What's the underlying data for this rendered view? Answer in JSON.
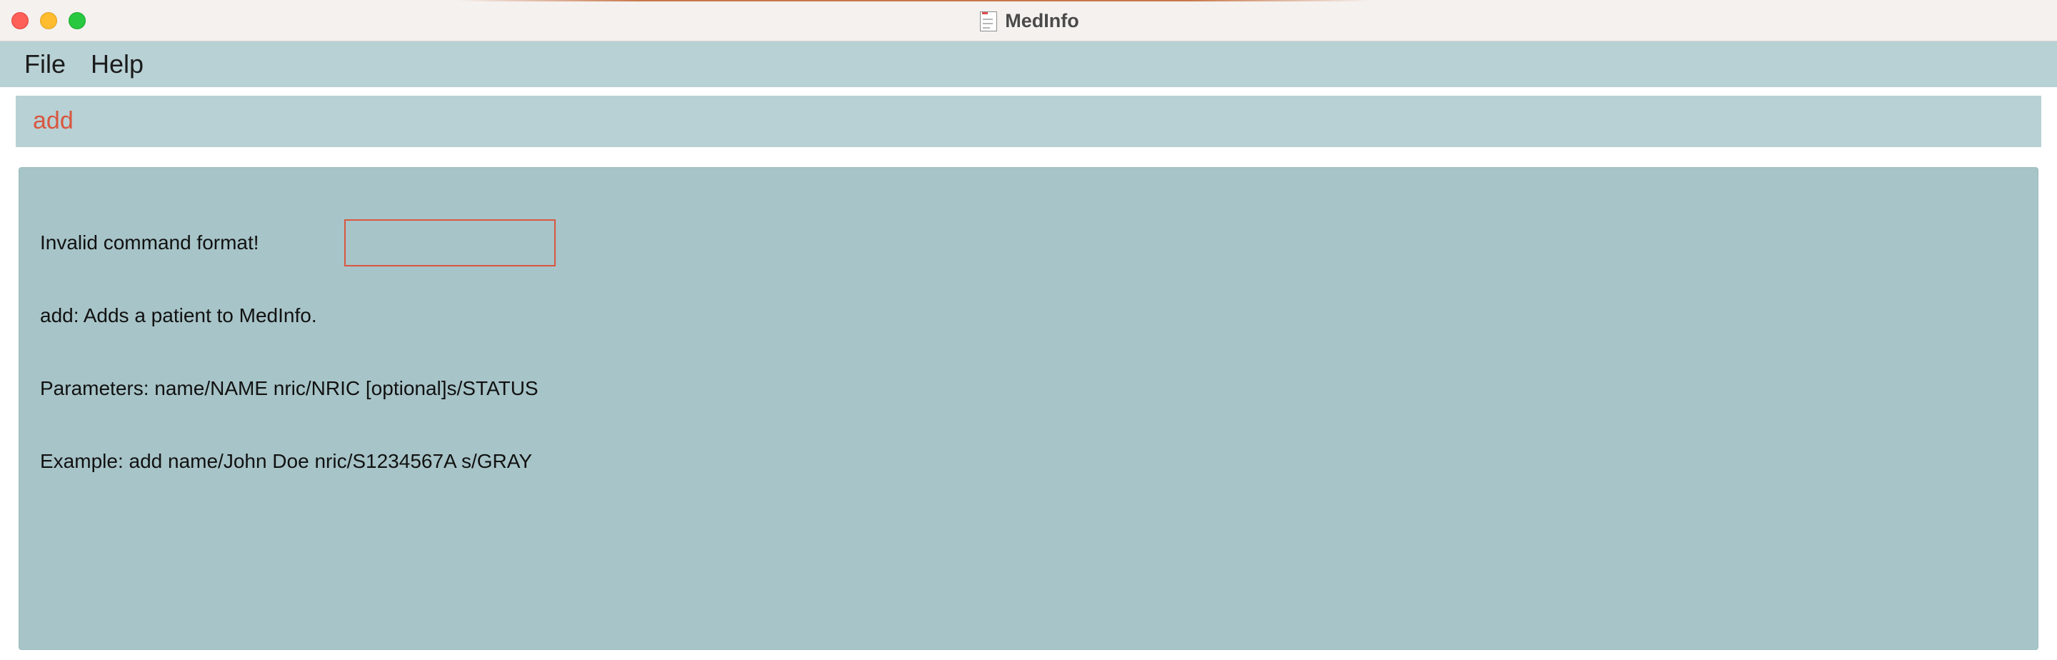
{
  "window": {
    "title": "MedInfo"
  },
  "menu": {
    "items": [
      {
        "label": "File"
      },
      {
        "label": "Help"
      }
    ]
  },
  "command_box": {
    "value": "add"
  },
  "result": {
    "lines": [
      "Invalid command format!",
      "add: Adds a patient to MedInfo.",
      "Parameters: name/NAME nric/NRIC [optional]s/STATUS",
      "Example: add name/John Doe nric/S1234567A s/GRAY"
    ]
  },
  "colors": {
    "menubar": "#b8d1d5",
    "command_text": "#d9563f",
    "result_background": "#a7c4c8",
    "highlight_border": "#d9563f"
  },
  "icons": {
    "app_icon": "document-app-icon",
    "close": "close-window-icon",
    "minimize": "minimize-window-icon",
    "maximize": "maximize-window-icon"
  }
}
